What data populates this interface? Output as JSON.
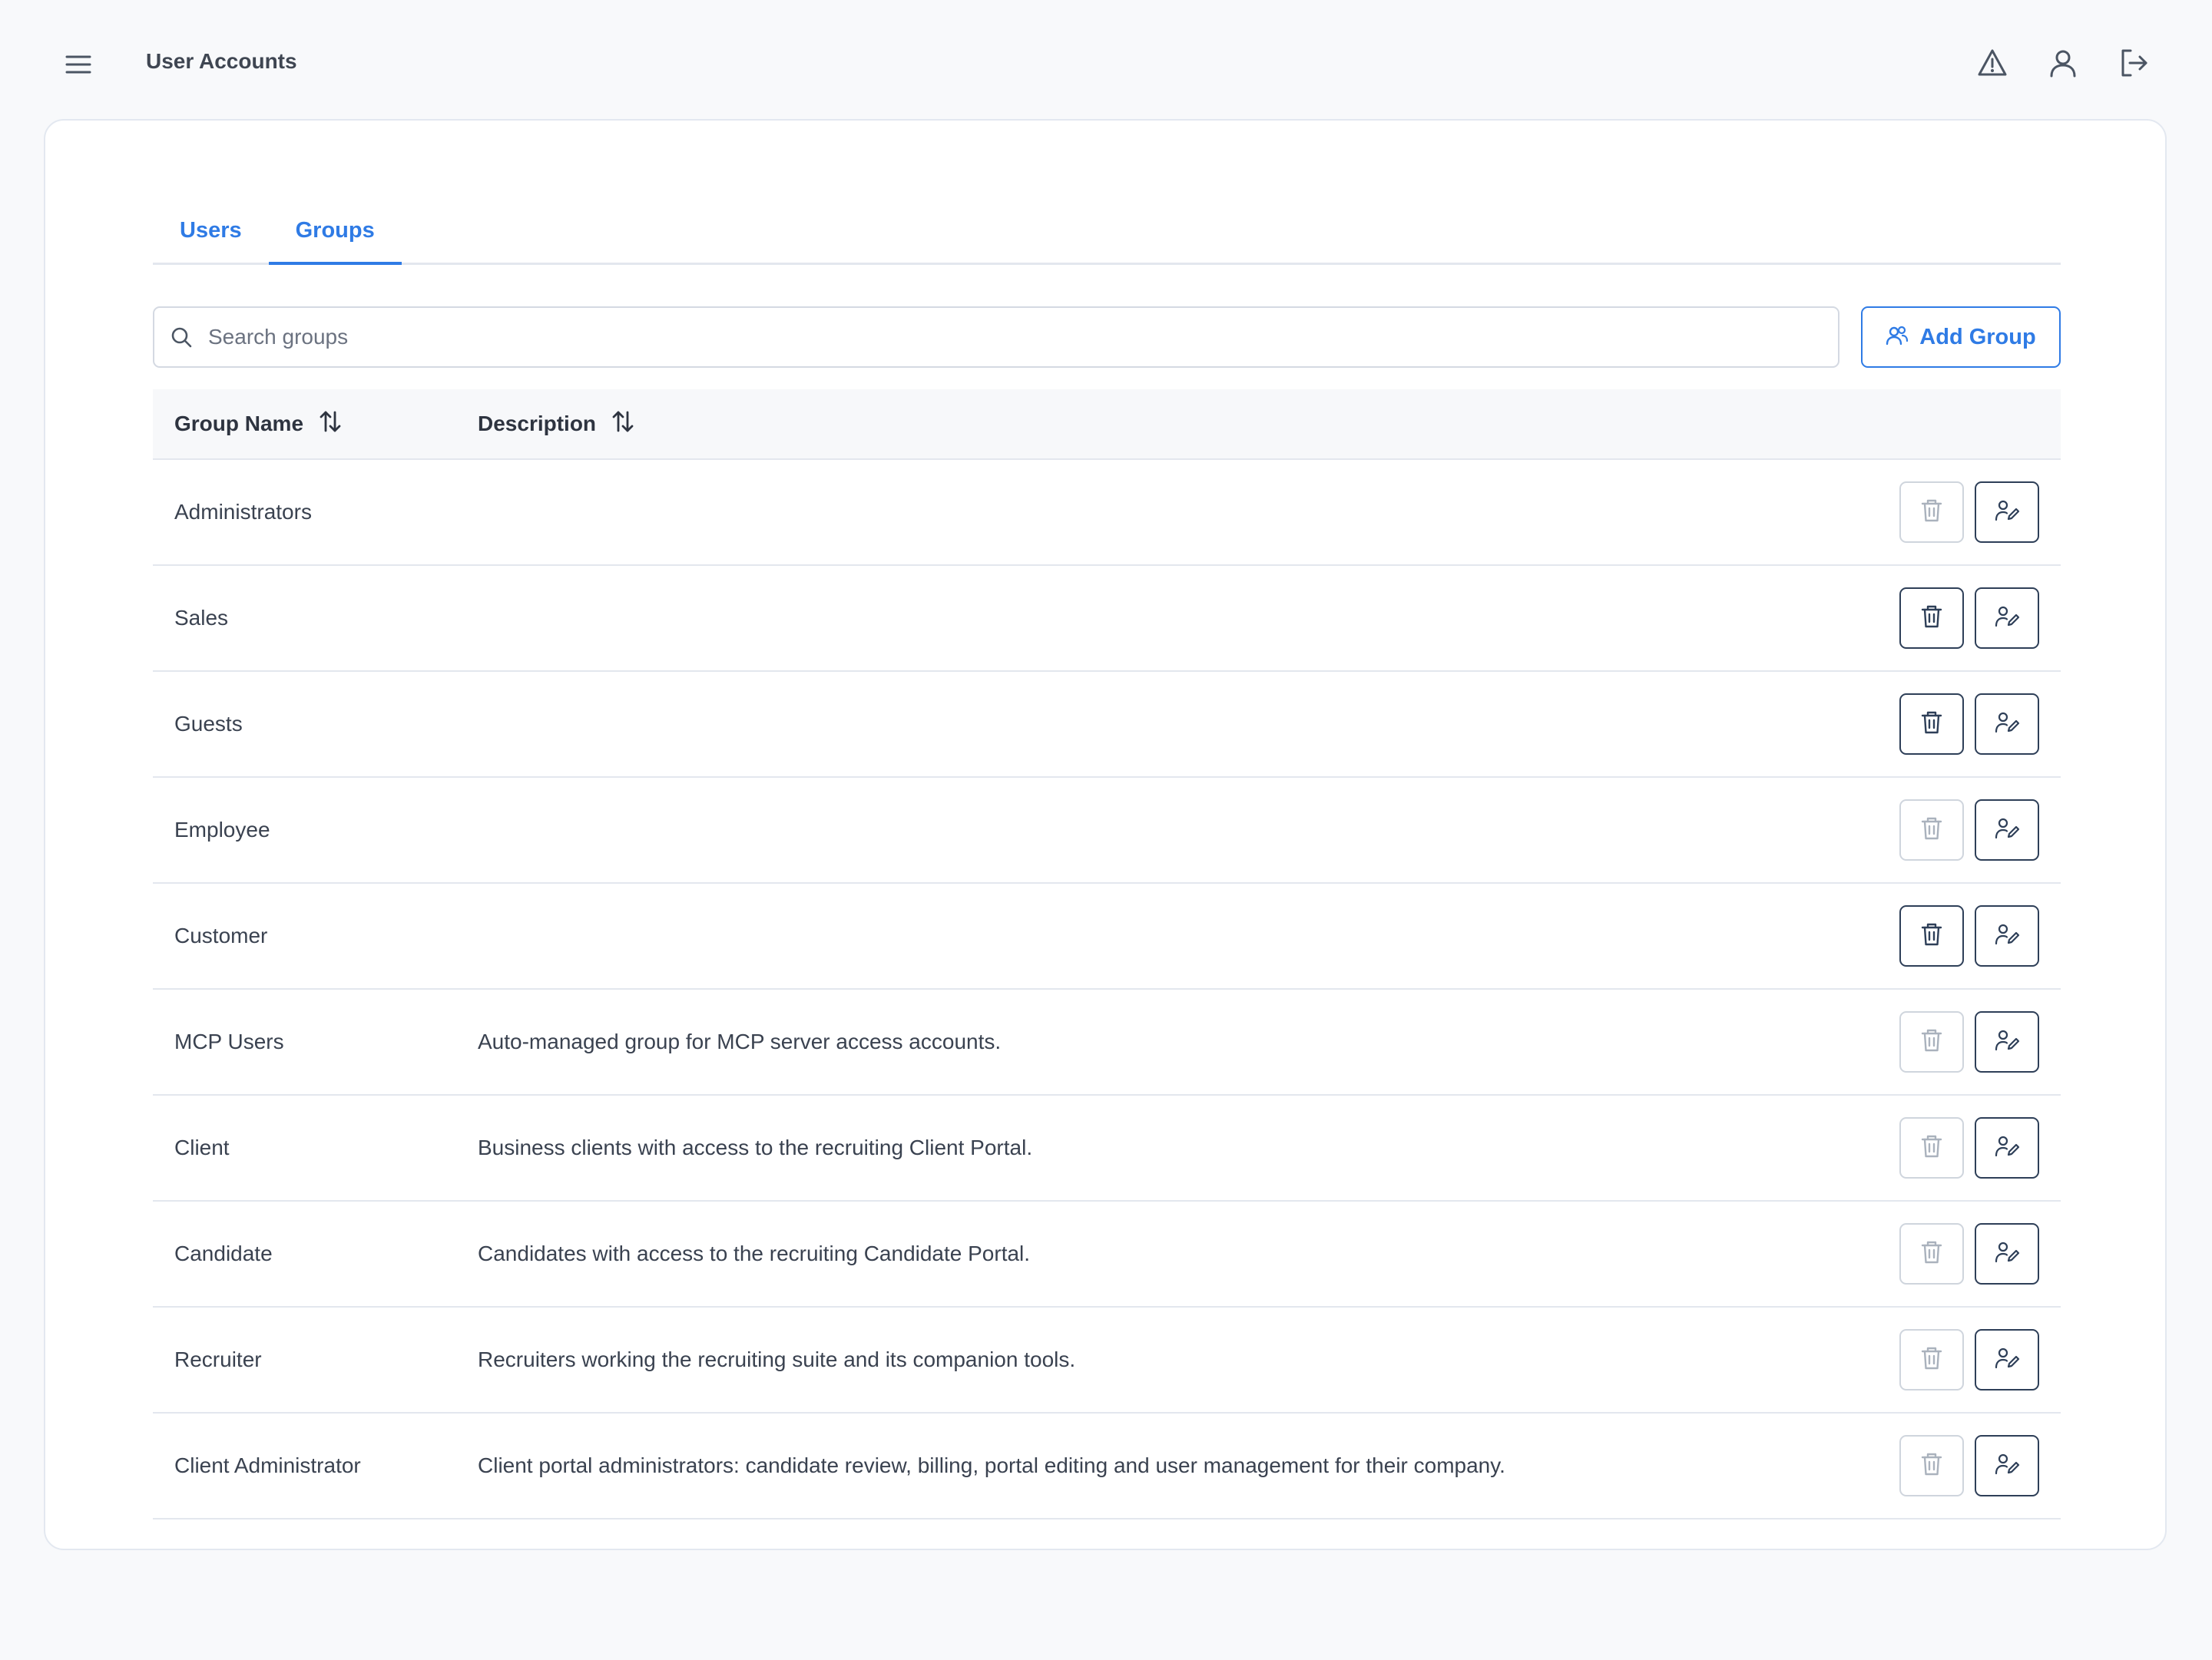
{
  "header": {
    "title": "User Accounts",
    "icons": [
      "menu-icon",
      "alert-triangle-icon",
      "user-icon",
      "logout-icon"
    ]
  },
  "tabs": [
    {
      "label": "Users",
      "active": false
    },
    {
      "label": "Groups",
      "active": true
    }
  ],
  "search": {
    "placeholder": "Search groups",
    "value": ""
  },
  "add_button": {
    "label": "Add Group",
    "icon": "users-icon"
  },
  "table": {
    "columns": [
      {
        "label": "Group Name",
        "icon": "sort-icon"
      },
      {
        "label": "Description",
        "icon": "sort-icon"
      }
    ],
    "rows": [
      {
        "name": "Administrators",
        "description": "",
        "delete_enabled": false
      },
      {
        "name": "Sales",
        "description": "",
        "delete_enabled": true
      },
      {
        "name": "Guests",
        "description": "",
        "delete_enabled": true
      },
      {
        "name": "Employee",
        "description": "",
        "delete_enabled": false
      },
      {
        "name": "Customer",
        "description": "",
        "delete_enabled": true
      },
      {
        "name": "MCP Users",
        "description": "Auto-managed group for MCP server access accounts.",
        "delete_enabled": false
      },
      {
        "name": "Client",
        "description": "Business clients with access to the recruiting Client Portal.",
        "delete_enabled": false
      },
      {
        "name": "Candidate",
        "description": "Candidates with access to the recruiting Candidate Portal.",
        "delete_enabled": false
      },
      {
        "name": "Recruiter",
        "description": "Recruiters working the recruiting suite and its companion tools.",
        "delete_enabled": false
      },
      {
        "name": "Client Administrator",
        "description": "Client portal administrators: candidate review, billing, portal editing and user management for their company.",
        "delete_enabled": false
      }
    ],
    "row_action_icons": [
      "trash-icon",
      "user-edit-icon"
    ]
  },
  "colors": {
    "accent": "#2f7be5",
    "background": "#f8f9fb",
    "border": "#e3e7ee",
    "action_border": "#2e3f58",
    "disabled_border": "#cfd5dd"
  }
}
